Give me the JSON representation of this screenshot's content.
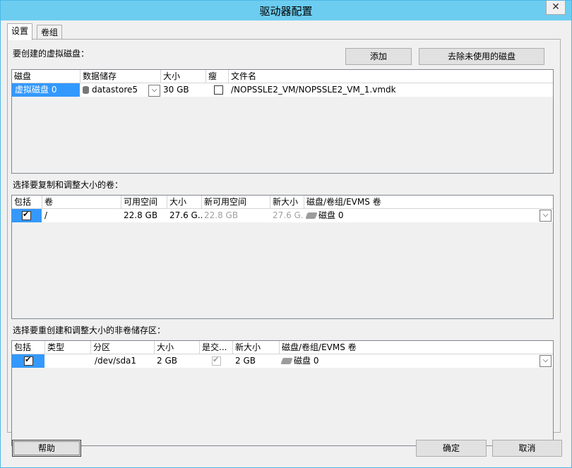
{
  "window": {
    "title": "驱动器配置",
    "close_glyph": "✕"
  },
  "tabs": [
    {
      "label": "设置",
      "active": true
    },
    {
      "label": "卷组",
      "active": false
    }
  ],
  "virtual_disks": {
    "section_label": "要创建的虚拟磁盘：",
    "add_button": "添加",
    "remove_unused_button": "去除未使用的磁盘",
    "columns": [
      "磁盘",
      "数据储存",
      "大小",
      "瘦",
      "文件名"
    ],
    "rows": [
      {
        "disk": "虚拟磁盘 0",
        "datastore": "datastore5",
        "size": "30 GB",
        "thin": false,
        "filename": "/NOPSSLE2_VM/NOPSSLE2_VM_1.vmdk"
      }
    ]
  },
  "volumes": {
    "section_label": "选择要复制和调整大小的卷：",
    "columns": [
      "包括",
      "卷",
      "可用空间",
      "大小",
      "新可用空间",
      "新大小",
      "磁盘/卷组/EVMS 卷"
    ],
    "rows": [
      {
        "include": true,
        "volume": "/",
        "free": "22.8 GB",
        "size": "27.6 G...",
        "new_free": "22.8 GB",
        "new_size": "27.6 G...",
        "target": "磁盘 0"
      }
    ]
  },
  "partitions": {
    "section_label": "选择要重创建和调整大小的非卷储存区：",
    "columns": [
      "包括",
      "类型",
      "分区",
      "大小",
      "是交...",
      "新大小",
      "磁盘/卷组/EVMS 卷"
    ],
    "rows": [
      {
        "include": true,
        "type": "",
        "partition": "/dev/sda1",
        "size": "2 GB",
        "is_swap": true,
        "new_size": "2 GB",
        "target": "磁盘 0"
      }
    ]
  },
  "footer": {
    "help": "帮助",
    "ok": "确定",
    "cancel": "取消"
  },
  "icons": {
    "dropdown": "chevron-down-icon",
    "disk": "disk-icon",
    "datastore": "database-icon"
  },
  "colors": {
    "title_bar": "#6ccdf0",
    "selection": "#3399ff"
  }
}
